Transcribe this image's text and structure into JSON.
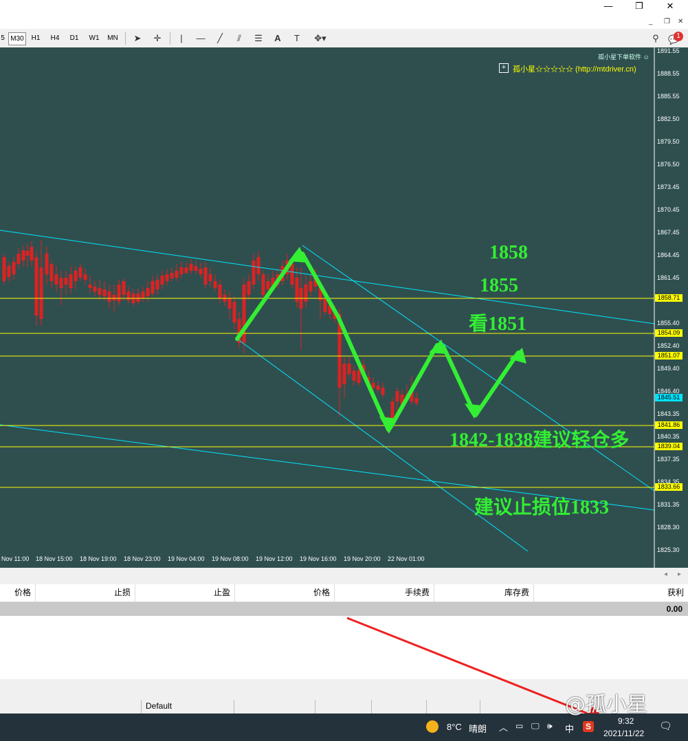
{
  "window": {
    "min_icon": "minimize-icon",
    "max_icon": "restore-icon",
    "close_icon": "close-icon"
  },
  "timeframes": [
    "5",
    "M30",
    "H1",
    "H4",
    "D1",
    "W1",
    "MN"
  ],
  "active_timeframe": "M30",
  "notification_count": "1",
  "chart": {
    "header_small": "孤小星下单软件 ☺",
    "indicator_label": "孤小星☆☆☆☆☆ (http://mtdriver.cn)",
    "y_ticks": [
      "1891.55",
      "1888.55",
      "1885.55",
      "1882.50",
      "1879.50",
      "1876.50",
      "1873.45",
      "1870.45",
      "1867.45",
      "1864.45",
      "1861.45",
      "1855.40",
      "1852.40",
      "1849.40",
      "1846.40",
      "1843.35",
      "1840.35",
      "1837.35",
      "1834.35",
      "1831.35",
      "1828.30",
      "1825.30"
    ],
    "level_labels": [
      "1858.71",
      "1854.09",
      "1851.07",
      "1845.51",
      "1841.86",
      "1839.04",
      "1833.66"
    ],
    "x_ticks": [
      "Nov 11:00",
      "18 Nov 15:00",
      "18 Nov 19:00",
      "18 Nov 23:00",
      "19 Nov 04:00",
      "19 Nov 08:00",
      "19 Nov 12:00",
      "19 Nov 16:00",
      "19 Nov 20:00",
      "22 Nov 01:00"
    ],
    "annotations": {
      "a1858": "1858",
      "a1855": "1855",
      "a1851": "看1851",
      "buy": "1842-1838建议轻仓多",
      "stop": "建议止损位1833"
    },
    "colors": {
      "background": "#2f4f4f",
      "bull": "#33ee33",
      "bear": "#dd2222",
      "level_line": "#ffff00",
      "trend_line": "#00e5ff",
      "arrow": "#33ee33"
    }
  },
  "terminal": {
    "columns": [
      "价格",
      "止损",
      "止盈",
      "价格",
      "手续费",
      "库存费",
      "获利"
    ],
    "total_profit": "0.00"
  },
  "statusbar": {
    "profile": "Default"
  },
  "watermark": "孤小星",
  "taskbar": {
    "weather_temp": "8°C",
    "weather_desc": "晴朗",
    "ime": "中",
    "time": "9:32",
    "date": "2021/11/22"
  }
}
